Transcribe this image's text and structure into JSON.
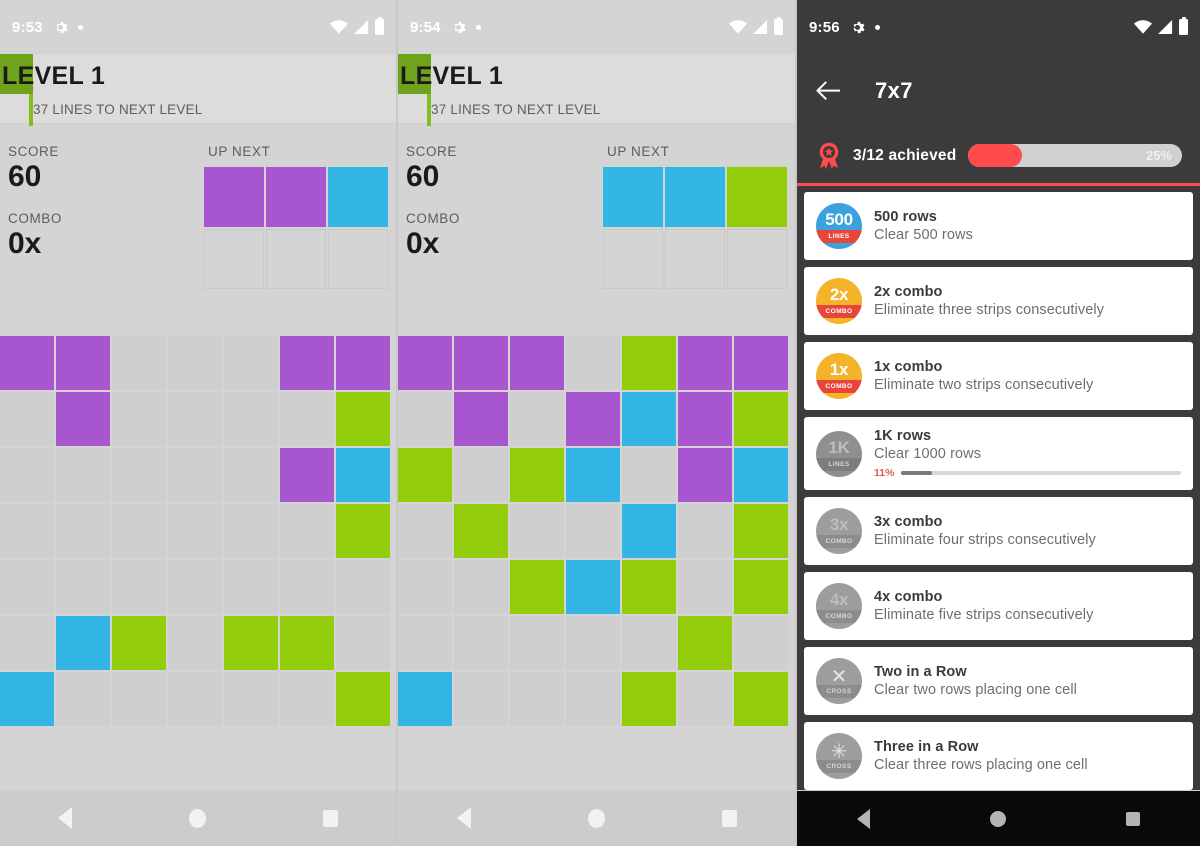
{
  "colors": {
    "purple": "#a855d0",
    "green": "#93cc0a",
    "blue": "#33b5e5",
    "empty": "#cfcfcf",
    "accent_red": "#ff4b4b",
    "panel_bg": "#d4d4d4",
    "dark_bg": "#3b3b3b"
  },
  "game_left": {
    "status": {
      "time": "9:53"
    },
    "level": {
      "title": "LEVEL 1",
      "subtitle": "37 LINES TO NEXT LEVEL"
    },
    "score": {
      "label": "SCORE",
      "value": "60"
    },
    "combo": {
      "label": "COMBO",
      "value": "0x"
    },
    "upnext": {
      "label": "UP NEXT",
      "cells": [
        "purple",
        "purple",
        "blue",
        "",
        "",
        ""
      ]
    },
    "board": {
      "rows": 7,
      "cols": 7,
      "cells": [
        [
          "purple",
          "purple",
          "",
          "",
          "",
          "purple",
          "purple"
        ],
        [
          "",
          "purple",
          "",
          "",
          "",
          "",
          "green"
        ],
        [
          "",
          "",
          "",
          "",
          "",
          "purple",
          "blue"
        ],
        [
          "",
          "",
          "",
          "",
          "",
          "",
          "green"
        ],
        [
          "",
          "",
          "",
          "",
          "",
          "",
          ""
        ],
        [
          "",
          "blue",
          "green",
          "",
          "green",
          "green",
          ""
        ],
        [
          "blue",
          "",
          "",
          "",
          "",
          "",
          "green"
        ]
      ]
    },
    "nav": {
      "back": "back-nav",
      "home": "home-nav",
      "recents": "recents-nav"
    }
  },
  "game_right": {
    "status": {
      "time": "9:54"
    },
    "level": {
      "title": "LEVEL 1",
      "subtitle": "37 LINES TO NEXT LEVEL"
    },
    "score": {
      "label": "SCORE",
      "value": "60"
    },
    "combo": {
      "label": "COMBO",
      "value": "0x"
    },
    "upnext": {
      "label": "UP NEXT",
      "cells": [
        "blue",
        "blue",
        "green",
        "",
        "",
        ""
      ]
    },
    "board": {
      "rows": 7,
      "cols": 7,
      "cells": [
        [
          "purple",
          "purple",
          "purple",
          "",
          "green",
          "purple",
          "purple"
        ],
        [
          "",
          "purple",
          "",
          "purple",
          "blue",
          "purple",
          "green"
        ],
        [
          "green",
          "",
          "green",
          "blue",
          "",
          "purple",
          "blue"
        ],
        [
          "",
          "green",
          "",
          "",
          "blue",
          "",
          "green"
        ],
        [
          "",
          "",
          "green",
          "blue",
          "green",
          "",
          "green"
        ],
        [
          "",
          "",
          "",
          "",
          "",
          "green",
          ""
        ],
        [
          "blue",
          "",
          "",
          "",
          "green",
          "",
          "green"
        ]
      ]
    },
    "nav": {
      "back": "back-nav",
      "home": "home-nav",
      "recents": "recents-nav"
    }
  },
  "achievements": {
    "status": {
      "time": "9:56"
    },
    "appbar": {
      "title": "7x7",
      "back_label": "Back"
    },
    "progress": {
      "text": "3/12 achieved",
      "percent_label": "25%",
      "percent": 25
    },
    "items": [
      {
        "name": "500 rows",
        "desc": "Clear 500 rows",
        "badge_text": "500",
        "badge_band": "LINES",
        "badge_top_color": "#3aa3dd",
        "badge_band_color": "#e8453c",
        "unlocked": true,
        "glyph": "",
        "progress_pct": null,
        "progress_label": ""
      },
      {
        "name": "2x combo",
        "desc": "Eliminate three strips consecutively",
        "badge_text": "2x",
        "badge_band": "COMBO",
        "badge_top_color": "#f5b32a",
        "badge_band_color": "#e8453c",
        "unlocked": true,
        "glyph": "",
        "progress_pct": null,
        "progress_label": ""
      },
      {
        "name": "1x combo",
        "desc": "Eliminate two strips consecutively",
        "badge_text": "1x",
        "badge_band": "COMBO",
        "badge_top_color": "#f5b32a",
        "badge_band_color": "#e8453c",
        "unlocked": true,
        "glyph": "",
        "progress_pct": null,
        "progress_label": ""
      },
      {
        "name": "1K rows",
        "desc": "Clear 1000 rows",
        "badge_text": "1K",
        "badge_band": "LINES",
        "badge_top_color": "#8f8f8f",
        "badge_band_color": "#7d7d7d",
        "unlocked": false,
        "glyph": "",
        "progress_pct": 11,
        "progress_label": "11%"
      },
      {
        "name": "3x combo",
        "desc": "Eliminate four strips consecutively",
        "badge_text": "3x",
        "badge_band": "COMBO",
        "badge_top_color": "#9d9d9d",
        "badge_band_color": "#8c8c8c",
        "unlocked": false,
        "glyph": "",
        "progress_pct": null,
        "progress_label": ""
      },
      {
        "name": "4x combo",
        "desc": "Eliminate five strips consecutively",
        "badge_text": "4x",
        "badge_band": "COMBO",
        "badge_top_color": "#9d9d9d",
        "badge_band_color": "#8c8c8c",
        "unlocked": false,
        "glyph": "",
        "progress_pct": null,
        "progress_label": ""
      },
      {
        "name": "Two in a Row",
        "desc": "Clear two rows placing one cell",
        "badge_text": "",
        "badge_band": "CROSS",
        "badge_top_color": "#9d9d9d",
        "badge_band_color": "#8c8c8c",
        "unlocked": false,
        "glyph": "✕",
        "progress_pct": null,
        "progress_label": ""
      },
      {
        "name": "Three in a Row",
        "desc": "Clear three rows placing one cell",
        "badge_text": "",
        "badge_band": "CROSS",
        "badge_top_color": "#9d9d9d",
        "badge_band_color": "#8c8c8c",
        "unlocked": false,
        "glyph": "✳",
        "progress_pct": null,
        "progress_label": ""
      }
    ],
    "nav": {
      "back": "back-nav",
      "home": "home-nav",
      "recents": "recents-nav"
    }
  }
}
